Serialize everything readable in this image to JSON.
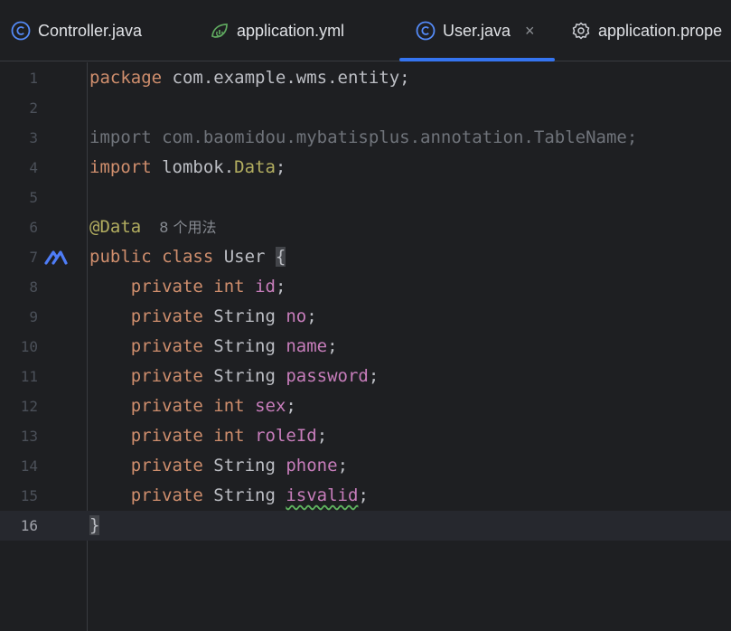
{
  "tabs": [
    {
      "label": "Controller.java",
      "icon": "java-class-icon",
      "active": false
    },
    {
      "label": "application.yml",
      "icon": "spring-leaf-icon",
      "active": false
    },
    {
      "label": "User.java",
      "icon": "java-class-icon",
      "active": true,
      "close": "×"
    },
    {
      "label": "application.prope",
      "icon": "gear-icon",
      "active": false
    }
  ],
  "editor": {
    "current_line": 16,
    "usage_hint": "8 个用法",
    "lines": [
      {
        "n": "1",
        "tokens": [
          [
            "kw",
            "package"
          ],
          [
            "plain",
            " com.example.wms.entity;"
          ]
        ]
      },
      {
        "n": "2",
        "tokens": []
      },
      {
        "n": "3",
        "tokens": [
          [
            "dim",
            "import com.baomidou.mybatisplus.annotation.TableName;"
          ]
        ]
      },
      {
        "n": "4",
        "tokens": [
          [
            "kw",
            "import"
          ],
          [
            "plain",
            " lombok."
          ],
          [
            "cls",
            "Data"
          ],
          [
            "plain",
            ";"
          ]
        ]
      },
      {
        "n": "5",
        "tokens": []
      },
      {
        "n": "6",
        "tokens": [
          [
            "ann",
            "@Data"
          ]
        ]
      },
      {
        "n": "7",
        "tokens": [
          [
            "kw",
            "public class"
          ],
          [
            "plain",
            " User "
          ],
          [
            "brace",
            "{"
          ]
        ]
      },
      {
        "n": "8",
        "tokens": [
          [
            "plain",
            "    "
          ],
          [
            "kw",
            "private int"
          ],
          [
            "plain",
            " "
          ],
          [
            "field",
            "id"
          ],
          [
            "plain",
            ";"
          ]
        ]
      },
      {
        "n": "9",
        "tokens": [
          [
            "plain",
            "    "
          ],
          [
            "kw",
            "private"
          ],
          [
            "plain",
            " String "
          ],
          [
            "field",
            "no"
          ],
          [
            "plain",
            ";"
          ]
        ]
      },
      {
        "n": "10",
        "tokens": [
          [
            "plain",
            "    "
          ],
          [
            "kw",
            "private"
          ],
          [
            "plain",
            " String "
          ],
          [
            "field",
            "name"
          ],
          [
            "plain",
            ";"
          ]
        ]
      },
      {
        "n": "11",
        "tokens": [
          [
            "plain",
            "    "
          ],
          [
            "kw",
            "private"
          ],
          [
            "plain",
            " String "
          ],
          [
            "field",
            "password"
          ],
          [
            "plain",
            ";"
          ]
        ]
      },
      {
        "n": "12",
        "tokens": [
          [
            "plain",
            "    "
          ],
          [
            "kw",
            "private int"
          ],
          [
            "plain",
            " "
          ],
          [
            "field",
            "sex"
          ],
          [
            "plain",
            ";"
          ]
        ]
      },
      {
        "n": "13",
        "tokens": [
          [
            "plain",
            "    "
          ],
          [
            "kw",
            "private int"
          ],
          [
            "plain",
            " "
          ],
          [
            "field",
            "roleId"
          ],
          [
            "plain",
            ";"
          ]
        ]
      },
      {
        "n": "14",
        "tokens": [
          [
            "plain",
            "    "
          ],
          [
            "kw",
            "private"
          ],
          [
            "plain",
            " String "
          ],
          [
            "field",
            "phone"
          ],
          [
            "plain",
            ";"
          ]
        ]
      },
      {
        "n": "15",
        "tokens": [
          [
            "plain",
            "    "
          ],
          [
            "kw",
            "private"
          ],
          [
            "plain",
            " String "
          ],
          [
            "field squiggle",
            "isvalid"
          ],
          [
            "plain",
            ";"
          ]
        ]
      },
      {
        "n": "16",
        "tokens": [
          [
            "brace",
            "}"
          ]
        ]
      }
    ]
  },
  "colors": {
    "accent": "#3574f0",
    "keyword": "#cf8e6d",
    "field": "#c77dbb",
    "annotation": "#b3ae60"
  }
}
